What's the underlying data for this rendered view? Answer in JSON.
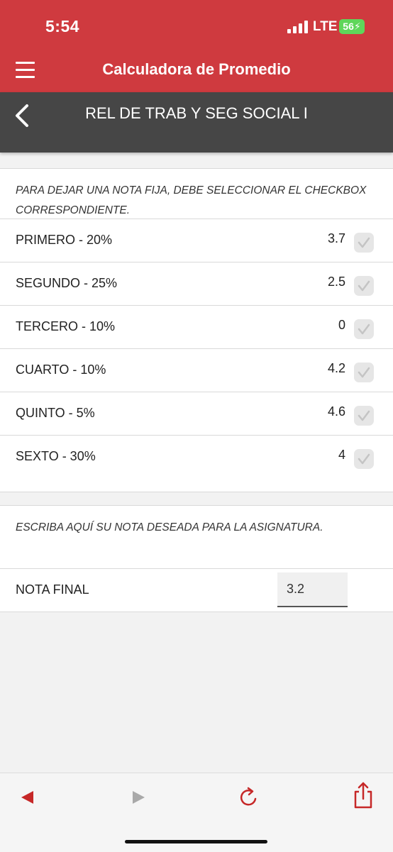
{
  "status_bar": {
    "time": "5:54",
    "carrier": "LTE",
    "battery": "56"
  },
  "app_bar": {
    "title": "Calculadora de Promedio",
    "menu_icon": "hamburger-icon",
    "color": "#cf3a3f"
  },
  "subject": {
    "title": "REL DE TRAB Y SEG SOCIAL I",
    "back_icon": "chevron-left-icon",
    "color": "#464646"
  },
  "grades": {
    "note": "PARA DEJAR UNA NOTA FIJA, DEBE SELECCIONAR EL CHECKBOX CORRESPONDIENTE.",
    "items": [
      {
        "label": "PRIMERO - 20%",
        "value": "3.7"
      },
      {
        "label": "SEGUNDO - 25%",
        "value": "2.5"
      },
      {
        "label": "TERCERO - 10%",
        "value": "0"
      },
      {
        "label": "CUARTO - 10%",
        "value": "4.2"
      },
      {
        "label": "QUINTO - 5%",
        "value": "4.6"
      },
      {
        "label": "SEXTO - 30%",
        "value": "4"
      }
    ]
  },
  "final": {
    "note": "ESCRIBA AQUÍ SU NOTA DESEADA PARA LA ASIGNATURA.",
    "label": "NOTA FINAL",
    "value": "3.2"
  },
  "toolbar": {
    "back_icon": "back-triangle-icon",
    "forward_icon": "forward-triangle-icon",
    "reload_icon": "reload-icon",
    "share_icon": "share-icon",
    "accent": "#c62828"
  }
}
